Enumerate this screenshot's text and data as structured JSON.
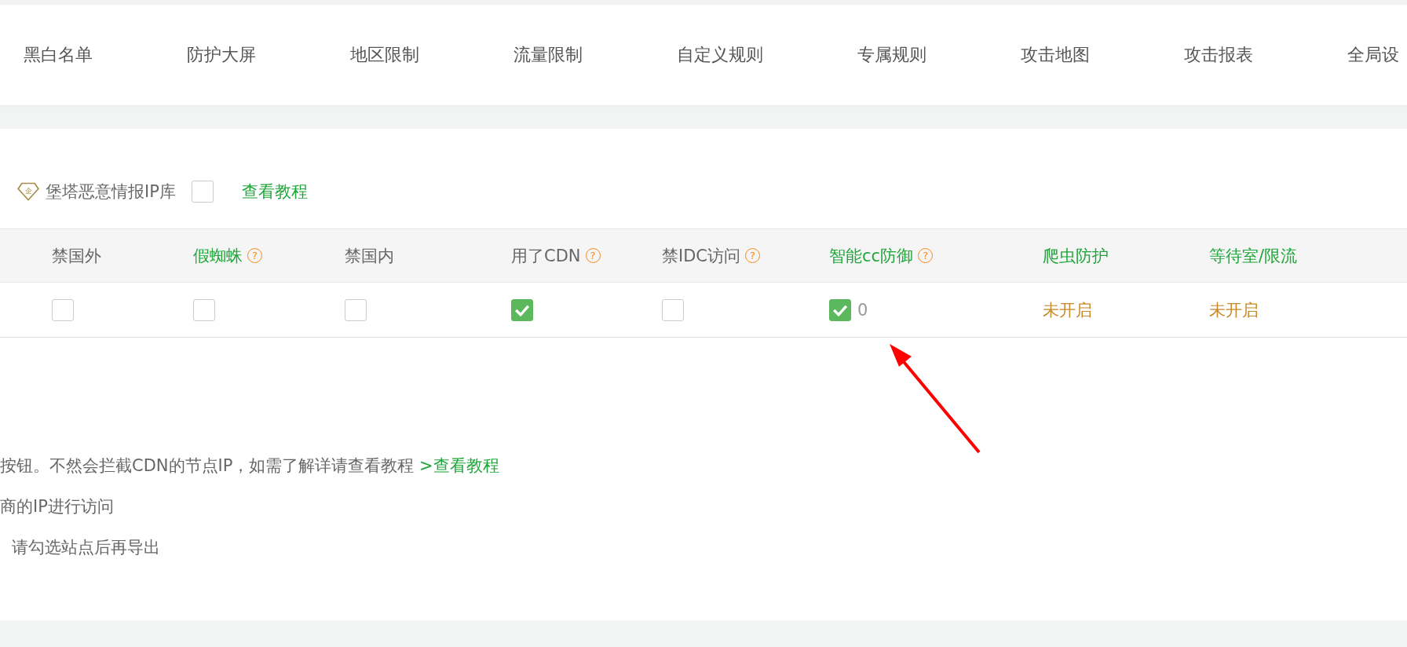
{
  "tabs": [
    {
      "label": "黑白名单"
    },
    {
      "label": "防护大屏"
    },
    {
      "label": "地区限制"
    },
    {
      "label": "流量限制"
    },
    {
      "label": "自定义规则"
    },
    {
      "label": "专属规则"
    },
    {
      "label": "攻击地图"
    },
    {
      "label": "攻击报表"
    },
    {
      "label": "全局设"
    }
  ],
  "intel": {
    "badge": "企",
    "label": "堡塔恶意情报IP库",
    "checked": false,
    "link": "查看教程"
  },
  "table": {
    "columns": [
      {
        "label": "禁国外",
        "kind": "plain"
      },
      {
        "label": "假蜘蛛",
        "kind": "highlight",
        "help": "?"
      },
      {
        "label": "禁国内",
        "kind": "plain"
      },
      {
        "label": "用了CDN",
        "kind": "plain",
        "help": "?"
      },
      {
        "label": "禁IDC访问",
        "kind": "plain",
        "help": "?"
      },
      {
        "label": "智能cc防御",
        "kind": "highlight",
        "help": "?"
      },
      {
        "label": "爬虫防护",
        "kind": "highlight"
      },
      {
        "label": "等待室/限流",
        "kind": "highlight"
      }
    ],
    "row": [
      {
        "kind": "checkbox",
        "checked": false
      },
      {
        "kind": "checkbox",
        "checked": false
      },
      {
        "kind": "checkbox",
        "checked": false
      },
      {
        "kind": "checkbox",
        "checked": true
      },
      {
        "kind": "checkbox",
        "checked": false
      },
      {
        "kind": "checkbox",
        "checked": true,
        "count": "0"
      },
      {
        "kind": "status",
        "text": "未开启"
      },
      {
        "kind": "status",
        "text": "未开启"
      }
    ]
  },
  "notes": [
    {
      "text": "按钮。不然会拦截CDN的节点IP，如需了解详请查看教程 ",
      "link": ">查看教程",
      "indent": false
    },
    {
      "text": "商的IP进行访问",
      "indent": false
    },
    {
      "text": "请勾选站点后再导出",
      "indent": true
    }
  ]
}
